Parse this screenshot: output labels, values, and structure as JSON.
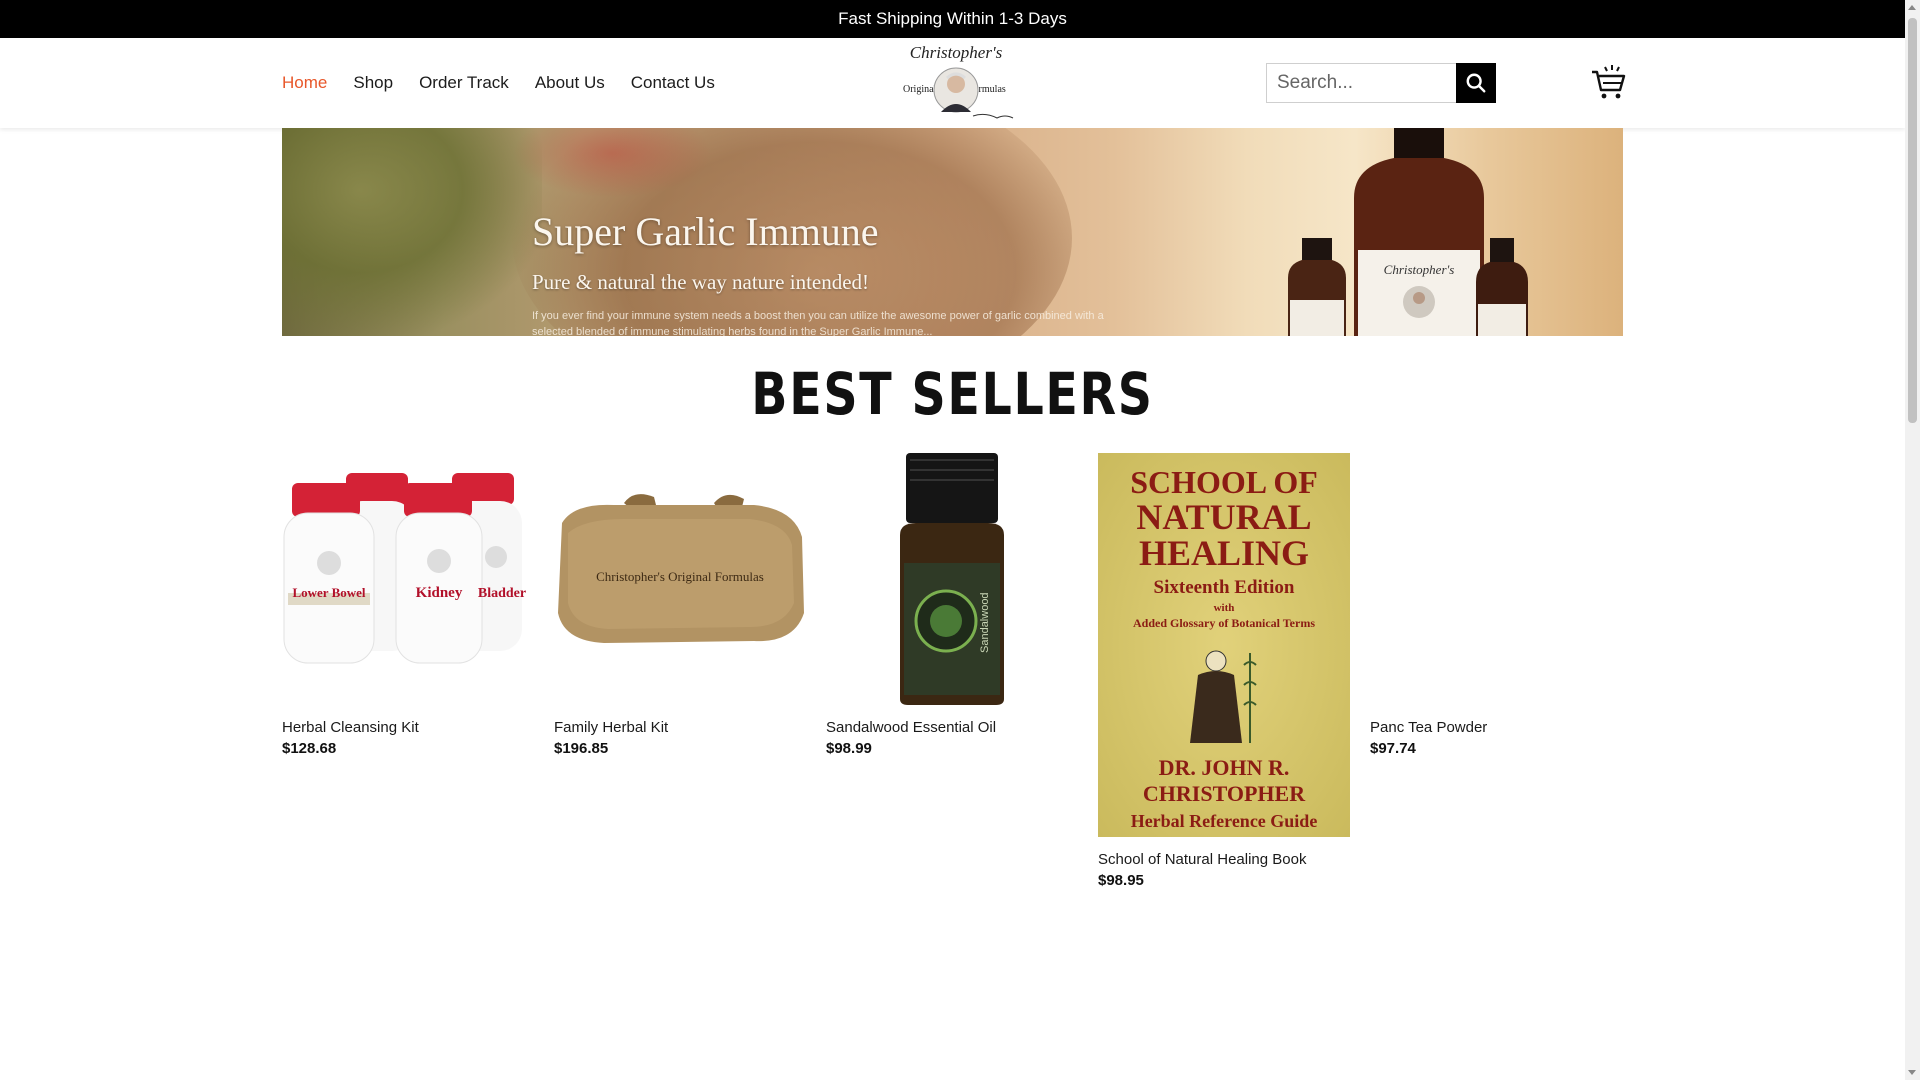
{
  "topbar": {
    "text": "Fast Shipping Within 1-3 Days"
  },
  "nav": {
    "items": [
      {
        "label": "Home",
        "active": true
      },
      {
        "label": "Shop"
      },
      {
        "label": "Order Track"
      },
      {
        "label": "About Us"
      },
      {
        "label": "Contact Us"
      }
    ]
  },
  "logo": {
    "line1": "Christopher's",
    "left": "Original",
    "right": "Formulas"
  },
  "search": {
    "placeholder": "Search..."
  },
  "banner": {
    "headline": "Super Garlic Immune",
    "subline": "Pure & natural the way nature intended!",
    "small": "If you ever find your immune system needs a boost then you can utilize the awesome power of garlic combined with a selected blended of immune stimulating herbs found in the Super Garlic Immune..."
  },
  "section": {
    "title": "BEST SELLERS"
  },
  "products": [
    {
      "name": "Herbal Cleansing Kit",
      "price": "$128.68"
    },
    {
      "name": "Family Herbal Kit",
      "price": "$196.85"
    },
    {
      "name": "Sandalwood Essential Oil",
      "price": "$98.99"
    },
    {
      "name": "School of Natural Healing Book",
      "price": "$98.95"
    },
    {
      "name": "Panc Tea Powder",
      "price": "$97.74"
    }
  ],
  "images": {
    "kit_labels": [
      "Lower Bowel",
      "Kidney",
      "Bladder"
    ],
    "bag_text": "Christopher's Original Formulas",
    "oil_label": "Sandalwood",
    "book": {
      "line1": "SCHOOL OF",
      "line2": "NATURAL",
      "line3": "HEALING",
      "edition": "Sixteenth Edition",
      "with": "with",
      "glossary": "Added Glossary of Botanical Terms",
      "author1": "DR. JOHN R.",
      "author2": "CHRISTOPHER",
      "guide": "Herbal Reference Guide"
    }
  },
  "colors": {
    "accent": "#e8572a",
    "topbar": "#000000",
    "book": "#d9c86a"
  }
}
